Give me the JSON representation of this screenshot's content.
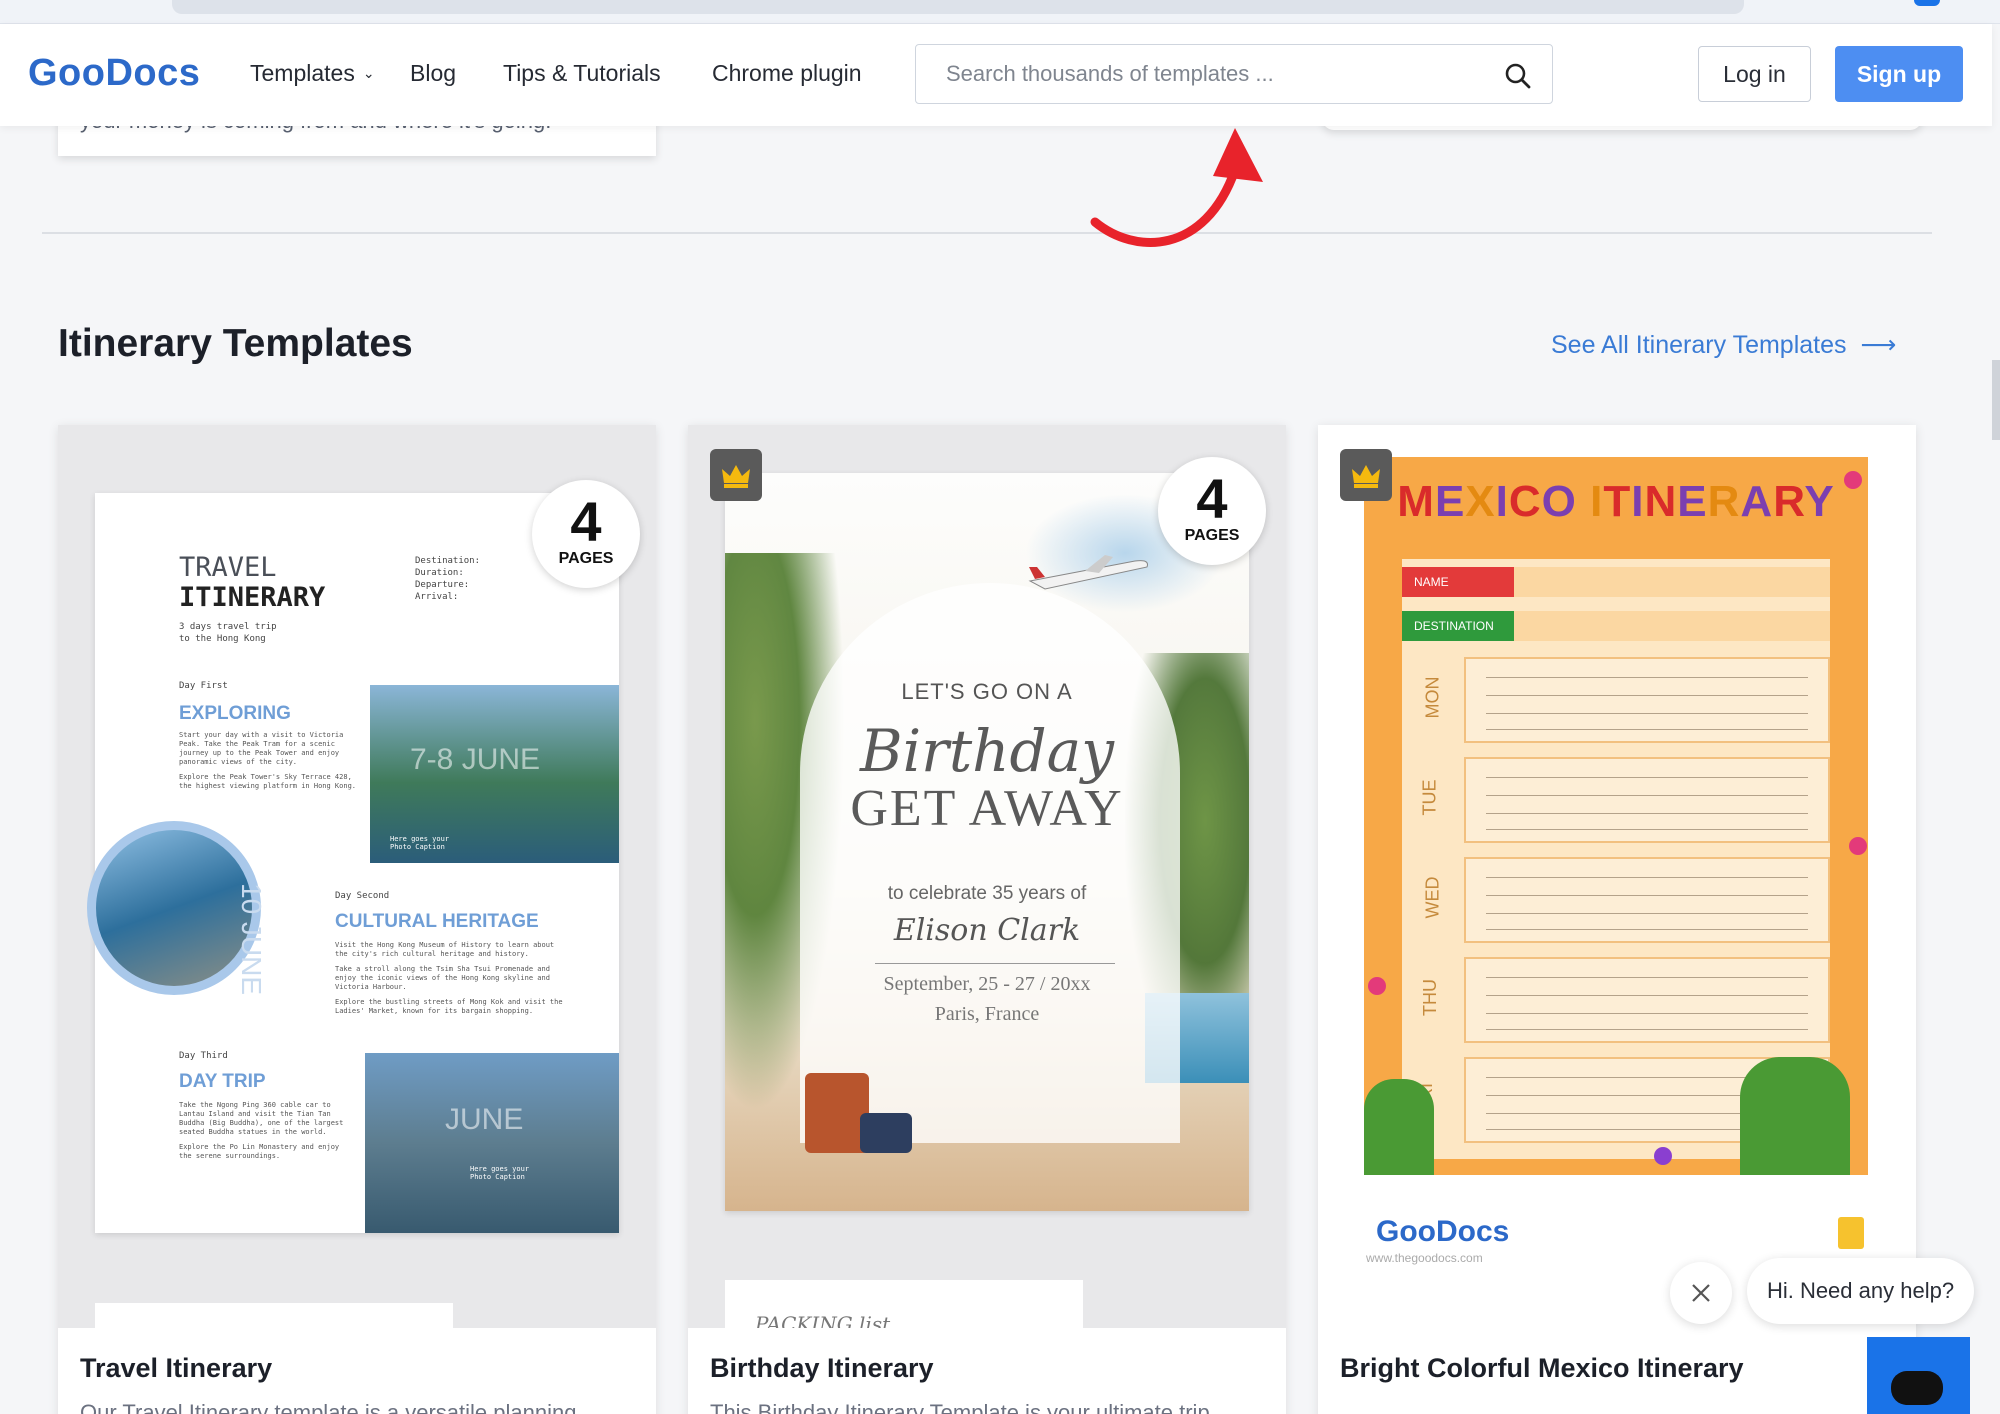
{
  "header": {
    "logo": "GooDocs",
    "nav": {
      "templates": "Templates",
      "blog": "Blog",
      "tips": "Tips & Tutorials",
      "chrome": "Chrome plugin"
    },
    "search_placeholder": "Search thousands of templates ...",
    "login": "Log in",
    "signup": "Sign up"
  },
  "previous_section": {
    "snippet": "your money is coming from and where it's going."
  },
  "section": {
    "title": "Itinerary Templates",
    "see_all": "See All Itinerary Templates",
    "see_all_arrow": "⟶"
  },
  "cards": [
    {
      "title": "Travel Itinerary",
      "description": "Our Travel Itinerary template is a versatile planning",
      "pages_num": "4",
      "pages_label": "PAGES",
      "premium": false,
      "preview": {
        "title_line1": "TRAVEL",
        "title_line2": "ITINERARY",
        "meta": [
          "Destination:",
          "Duration:",
          "Departure:",
          "Arrival:"
        ],
        "subtitle": [
          "3 days travel trip",
          "to the Hong Kong"
        ],
        "day1": "Day First",
        "heading1": "EXPLORING",
        "text1": [
          "Start your day with a visit to Victoria",
          "Peak. Take the Peak Tram for a scenic",
          "journey up to the Peak Tower and enjoy",
          "panoramic views of the city.",
          "",
          "Explore the Peak Tower's Sky Terrace 428,",
          "the highest viewing platform in Hong Kong."
        ],
        "ghost1": "7-8 JUNE",
        "caption": [
          "Here goes your",
          "Photo Caption"
        ],
        "vertical": "10 JUNE",
        "day2": "Day Second",
        "heading2": "CULTURAL HERITAGE",
        "text2": [
          "Visit the Hong Kong Museum of History to learn about",
          "the city's rich cultural heritage and history.",
          "",
          "Take a stroll along the Tsim Sha Tsui Promenade and",
          "enjoy the iconic views of the Hong Kong skyline and",
          "Victoria Harbour.",
          "",
          "Explore the bustling streets of Mong Kok and visit the",
          "Ladies' Market, known for its bargain shopping."
        ],
        "day3": "Day Third",
        "heading3": "DAY TRIP",
        "text3": [
          "Take the Ngong Ping 360 cable car to",
          "Lantau Island and visit the Tian Tan",
          "Buddha (Big Buddha), one of the largest",
          "seated Buddha statues in the world.",
          "",
          "Explore the Po Lin Monastery and enjoy",
          "the serene surroundings."
        ],
        "ghost2": "JUNE"
      }
    },
    {
      "title": "Birthday Itinerary",
      "description": "This Birthday Itinerary Template is your ultimate trip",
      "pages_num": "4",
      "pages_label": "PAGES",
      "premium": true,
      "preview": {
        "lets": "LET'S GO ON A",
        "birthday": "Birthday",
        "getaway": "GET AWAY",
        "celebrate": "to celebrate 35 years of",
        "name": "Elison Clark",
        "date": "September, 25 - 27 / 20xx",
        "place": "Paris, France",
        "next_page": "PACKING list"
      }
    },
    {
      "title": "Bright Colorful Mexico Itinerary",
      "description": "",
      "premium": true,
      "preview": {
        "title_letters": [
          "M",
          "E",
          "X",
          "I",
          "C",
          "O",
          " ",
          "I",
          "T",
          "I",
          "N",
          "E",
          "R",
          "A",
          "R",
          "Y"
        ],
        "name_label": "NAME",
        "destination_label": "DESTINATION",
        "days": [
          "MON",
          "TUE",
          "WED",
          "THU",
          "FRI"
        ],
        "brand": "GooDocs",
        "brand_url": "www.thegoodocs.com"
      }
    }
  ],
  "chat": {
    "bubble": "Hi. Need any help?"
  },
  "colors": {
    "brand_blue": "#2c69c9",
    "signup_bg": "#4d8ef2",
    "link": "#3a7bd5",
    "annotation_red": "#e8232b",
    "chat_blue": "#1a73e8"
  },
  "icons": [
    "search-icon",
    "chevron-down-icon",
    "crown-icon",
    "arrow-right-icon",
    "close-icon",
    "chat-icon",
    "doc-file-icon"
  ]
}
